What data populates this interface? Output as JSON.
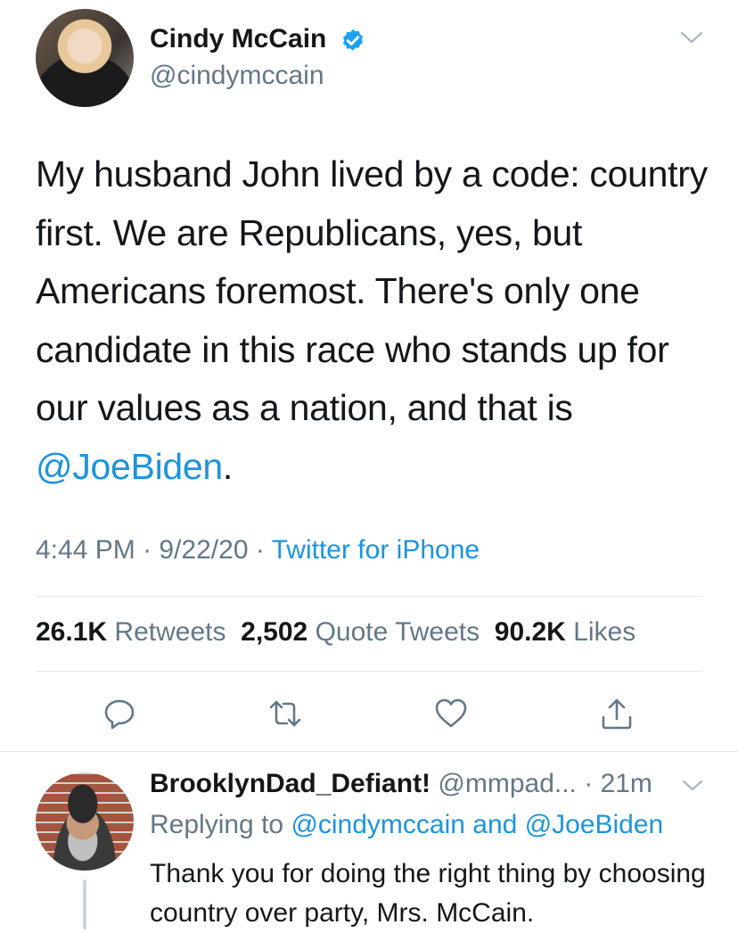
{
  "tweet": {
    "author_name": "Cindy McCain",
    "author_handle": "@cindymccain",
    "text_before": "My husband John lived by a code: country first. We are Republicans, yes, but Americans foremost. There's only one candidate in this race who stands up for our values as a nation, and that is ",
    "mention": "@JoeBiden",
    "text_after": ".",
    "time": "4:44 PM",
    "date": "9/22/20",
    "source": "Twitter for iPhone",
    "separator": " · "
  },
  "stats": {
    "retweets_count": "26.1K",
    "retweets_label": "Retweets",
    "quotes_count": "2,502",
    "quotes_label": "Quote Tweets",
    "likes_count": "90.2K",
    "likes_label": "Likes"
  },
  "actions": {
    "reply_icon": "reply-icon",
    "retweet_icon": "retweet-icon",
    "like_icon": "heart-icon",
    "share_icon": "share-icon"
  },
  "reply": {
    "author_name": "BrooklynDad_Defiant!",
    "author_handle": "@mmpad...",
    "time": "21m",
    "separator": " · ",
    "replying_prefix": "Replying to ",
    "replying_to_1": "@cindymccain",
    "replying_and": " and ",
    "replying_to_2": "@JoeBiden",
    "text": "Thank you for doing the right thing by choosing country over party, Mrs. McCain."
  },
  "colors": {
    "accent": "#1b95e0",
    "secondary_text": "#657786",
    "divider": "#e1e8ed",
    "verified": "#1da1f2"
  }
}
